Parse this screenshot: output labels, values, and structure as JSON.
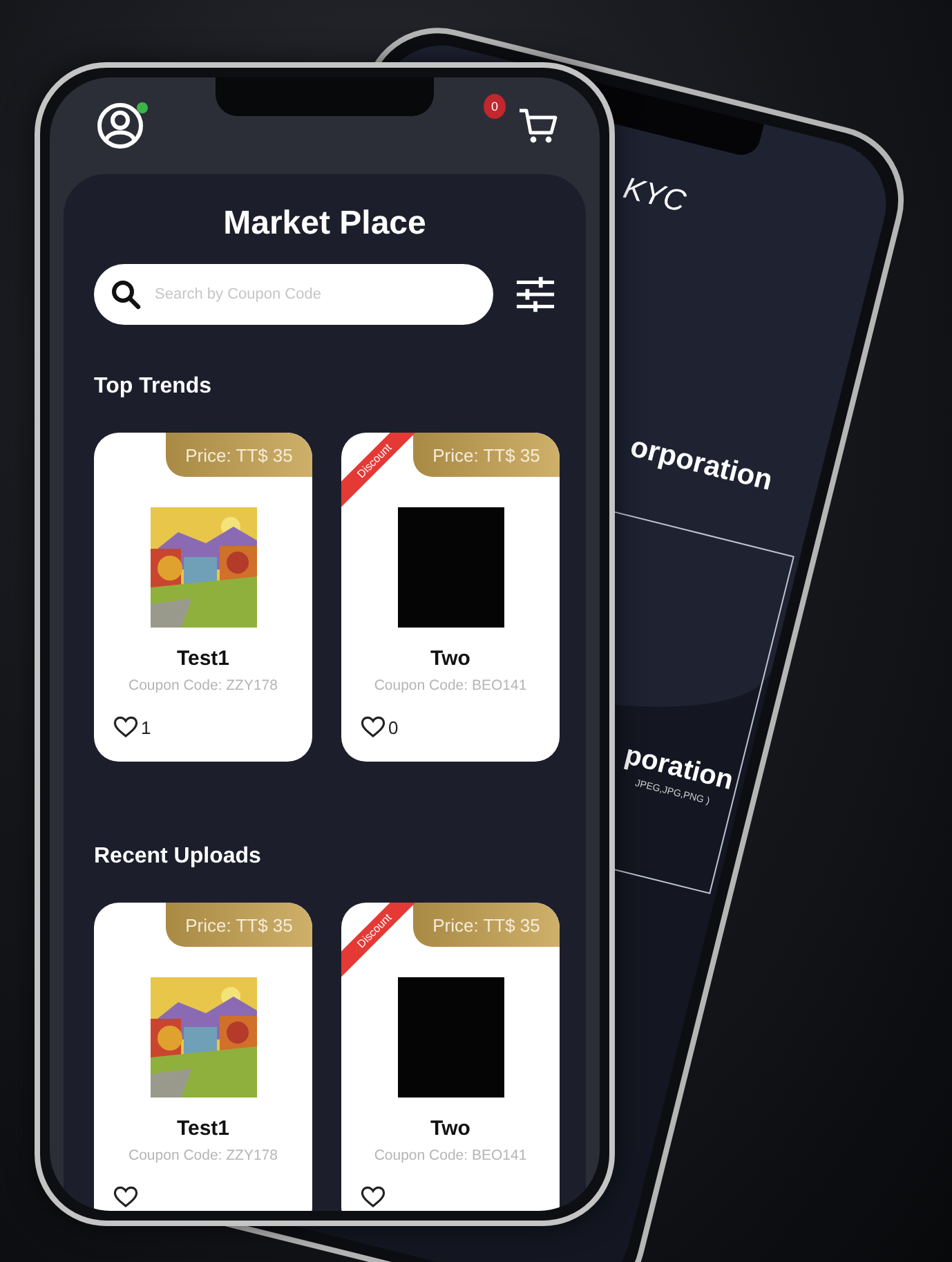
{
  "back_screen": {
    "title": "KYC",
    "lines": [
      "orporation",
      "poration",
      "JPEG,JPG,PNG )"
    ]
  },
  "header": {
    "avatar_online": true,
    "cart_badge": "0"
  },
  "title": "Market Place",
  "search": {
    "placeholder": "Search by Coupon Code"
  },
  "sections": [
    {
      "heading": "Top Trends",
      "items": [
        {
          "price": "Price: TT$ 35",
          "kind": "picture",
          "name": "Test1",
          "coupon": "Coupon Code: ZZY178",
          "likes": "1"
        },
        {
          "price": "Price: TT$ 35",
          "ribbon": "Discount",
          "kind": "blank",
          "name": "Two",
          "coupon": "Coupon Code: BEO141",
          "likes": "0"
        }
      ]
    },
    {
      "heading": "Recent Uploads",
      "items": [
        {
          "price": "Price: TT$ 35",
          "kind": "picture",
          "name": "Test1",
          "coupon": "Coupon Code: ZZY178"
        },
        {
          "price": "Price: TT$ 35",
          "ribbon": "Discount",
          "kind": "blank",
          "name": "Two",
          "coupon": "Coupon Code: BEO141"
        }
      ]
    }
  ]
}
